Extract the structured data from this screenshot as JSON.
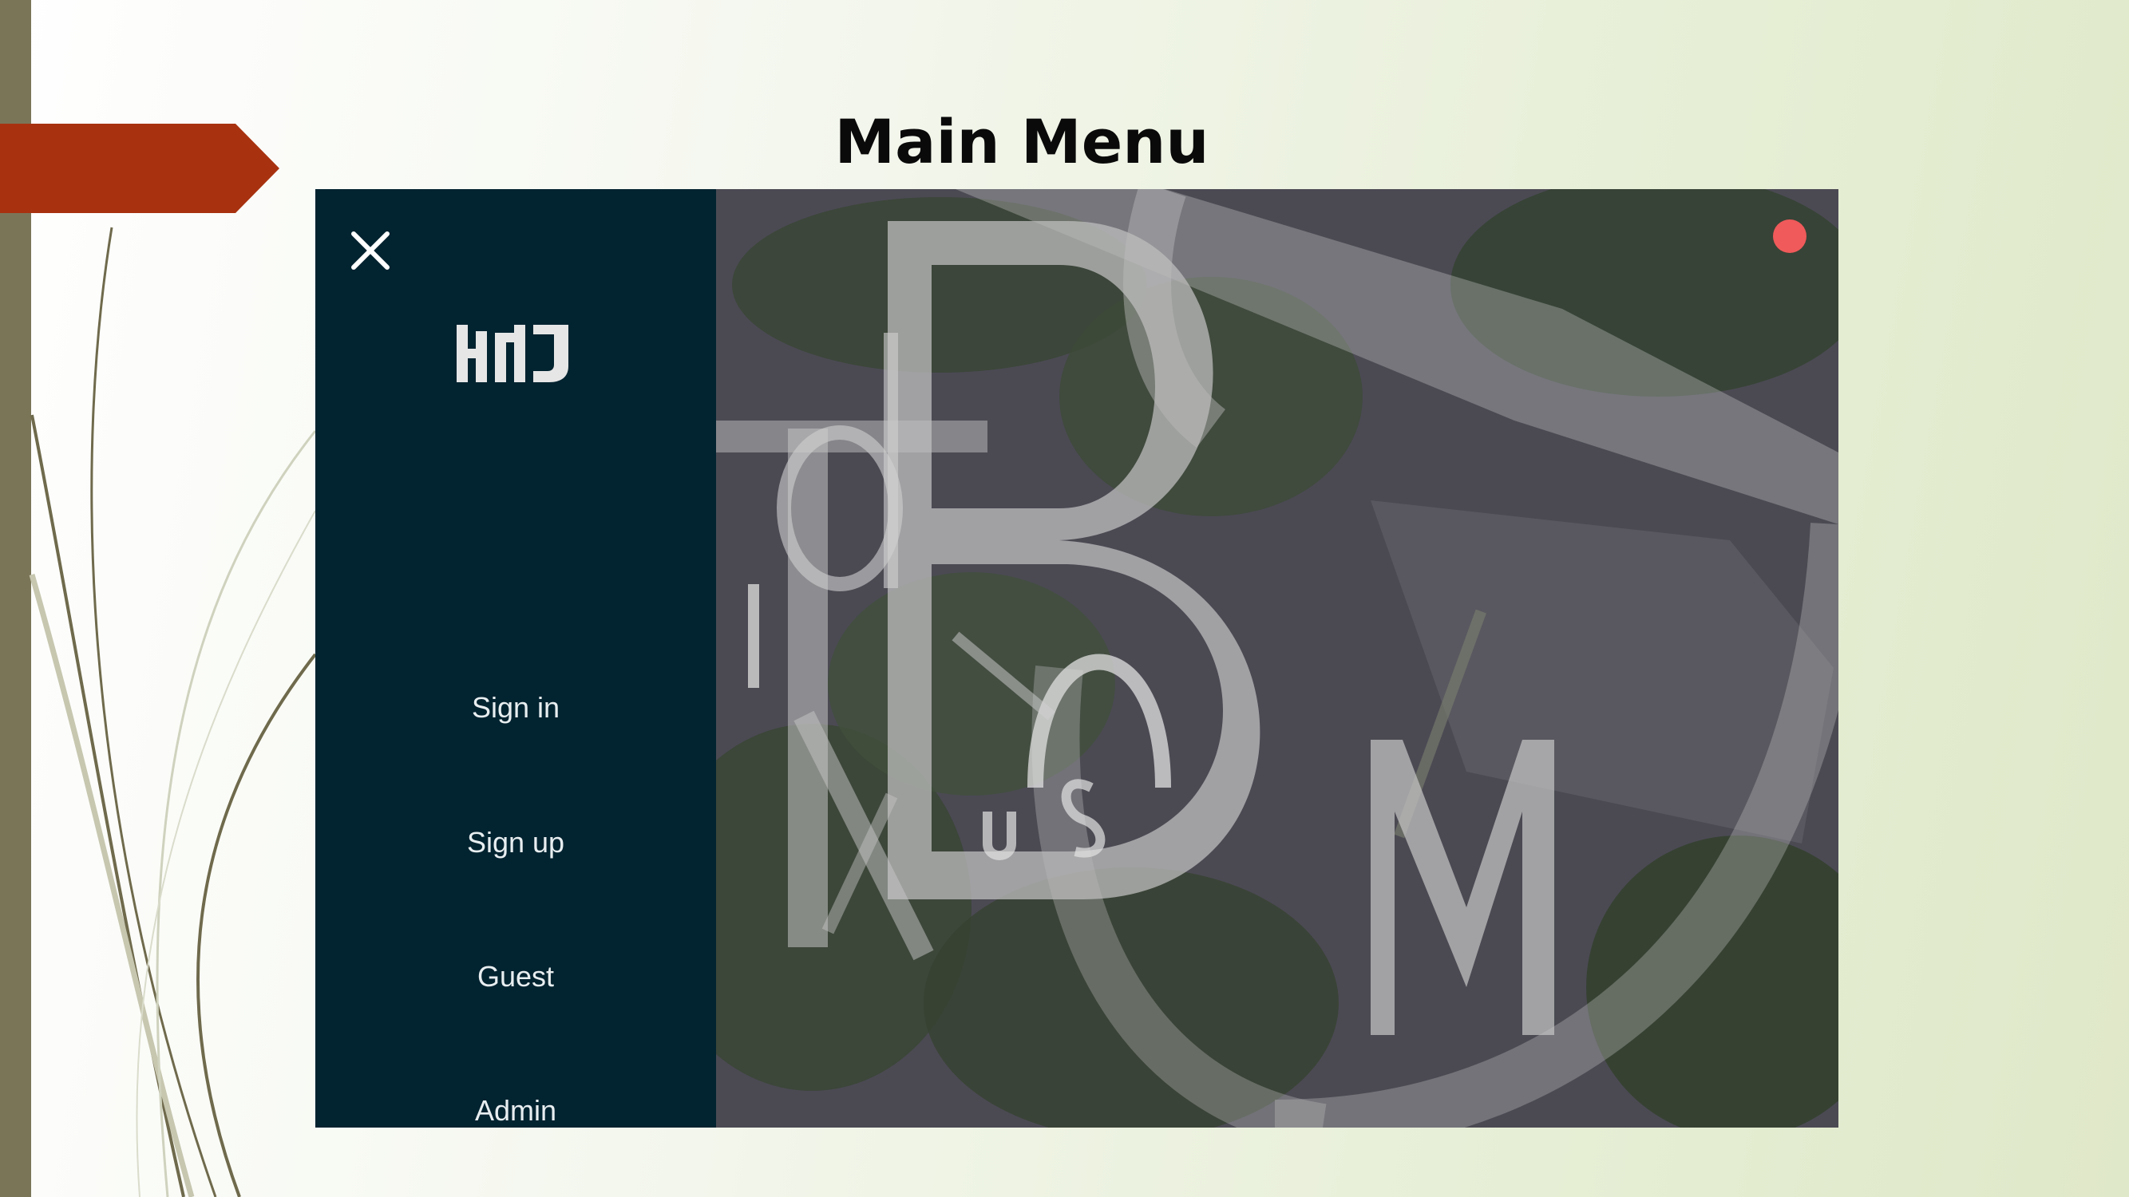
{
  "slide": {
    "title": "Main Menu",
    "accent_color": "#a83210",
    "bar_color": "#7b7558"
  },
  "app": {
    "sidebar": {
      "background": "#022330",
      "close_icon": "close-icon",
      "logo_text": "HHJ",
      "items": [
        {
          "label": "Sign in"
        },
        {
          "label": "Sign up"
        },
        {
          "label": "Guest"
        },
        {
          "label": "Admin"
        }
      ]
    },
    "hero": {
      "status_dot_color": "#f05a5a"
    }
  }
}
